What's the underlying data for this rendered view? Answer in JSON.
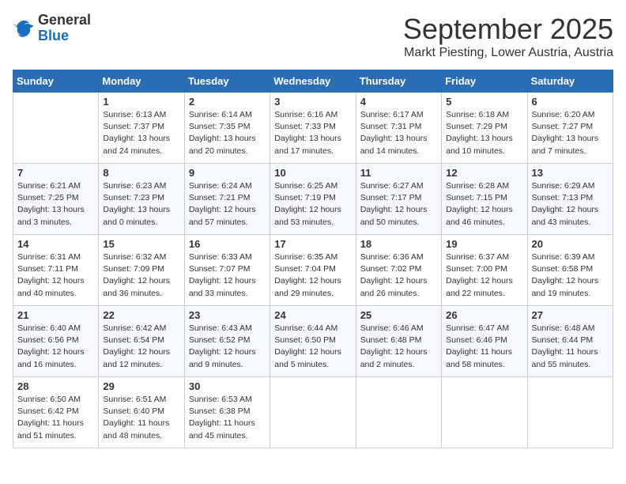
{
  "header": {
    "logo": {
      "line1": "General",
      "line2": "Blue"
    },
    "title": "September 2025",
    "subtitle": "Markt Piesting, Lower Austria, Austria"
  },
  "days_of_week": [
    "Sunday",
    "Monday",
    "Tuesday",
    "Wednesday",
    "Thursday",
    "Friday",
    "Saturday"
  ],
  "weeks": [
    [
      {
        "day": "",
        "content": ""
      },
      {
        "day": "1",
        "content": "Sunrise: 6:13 AM\nSunset: 7:37 PM\nDaylight: 13 hours\nand 24 minutes."
      },
      {
        "day": "2",
        "content": "Sunrise: 6:14 AM\nSunset: 7:35 PM\nDaylight: 13 hours\nand 20 minutes."
      },
      {
        "day": "3",
        "content": "Sunrise: 6:16 AM\nSunset: 7:33 PM\nDaylight: 13 hours\nand 17 minutes."
      },
      {
        "day": "4",
        "content": "Sunrise: 6:17 AM\nSunset: 7:31 PM\nDaylight: 13 hours\nand 14 minutes."
      },
      {
        "day": "5",
        "content": "Sunrise: 6:18 AM\nSunset: 7:29 PM\nDaylight: 13 hours\nand 10 minutes."
      },
      {
        "day": "6",
        "content": "Sunrise: 6:20 AM\nSunset: 7:27 PM\nDaylight: 13 hours\nand 7 minutes."
      }
    ],
    [
      {
        "day": "7",
        "content": "Sunrise: 6:21 AM\nSunset: 7:25 PM\nDaylight: 13 hours\nand 3 minutes."
      },
      {
        "day": "8",
        "content": "Sunrise: 6:23 AM\nSunset: 7:23 PM\nDaylight: 13 hours\nand 0 minutes."
      },
      {
        "day": "9",
        "content": "Sunrise: 6:24 AM\nSunset: 7:21 PM\nDaylight: 12 hours\nand 57 minutes."
      },
      {
        "day": "10",
        "content": "Sunrise: 6:25 AM\nSunset: 7:19 PM\nDaylight: 12 hours\nand 53 minutes."
      },
      {
        "day": "11",
        "content": "Sunrise: 6:27 AM\nSunset: 7:17 PM\nDaylight: 12 hours\nand 50 minutes."
      },
      {
        "day": "12",
        "content": "Sunrise: 6:28 AM\nSunset: 7:15 PM\nDaylight: 12 hours\nand 46 minutes."
      },
      {
        "day": "13",
        "content": "Sunrise: 6:29 AM\nSunset: 7:13 PM\nDaylight: 12 hours\nand 43 minutes."
      }
    ],
    [
      {
        "day": "14",
        "content": "Sunrise: 6:31 AM\nSunset: 7:11 PM\nDaylight: 12 hours\nand 40 minutes."
      },
      {
        "day": "15",
        "content": "Sunrise: 6:32 AM\nSunset: 7:09 PM\nDaylight: 12 hours\nand 36 minutes."
      },
      {
        "day": "16",
        "content": "Sunrise: 6:33 AM\nSunset: 7:07 PM\nDaylight: 12 hours\nand 33 minutes."
      },
      {
        "day": "17",
        "content": "Sunrise: 6:35 AM\nSunset: 7:04 PM\nDaylight: 12 hours\nand 29 minutes."
      },
      {
        "day": "18",
        "content": "Sunrise: 6:36 AM\nSunset: 7:02 PM\nDaylight: 12 hours\nand 26 minutes."
      },
      {
        "day": "19",
        "content": "Sunrise: 6:37 AM\nSunset: 7:00 PM\nDaylight: 12 hours\nand 22 minutes."
      },
      {
        "day": "20",
        "content": "Sunrise: 6:39 AM\nSunset: 6:58 PM\nDaylight: 12 hours\nand 19 minutes."
      }
    ],
    [
      {
        "day": "21",
        "content": "Sunrise: 6:40 AM\nSunset: 6:56 PM\nDaylight: 12 hours\nand 16 minutes."
      },
      {
        "day": "22",
        "content": "Sunrise: 6:42 AM\nSunset: 6:54 PM\nDaylight: 12 hours\nand 12 minutes."
      },
      {
        "day": "23",
        "content": "Sunrise: 6:43 AM\nSunset: 6:52 PM\nDaylight: 12 hours\nand 9 minutes."
      },
      {
        "day": "24",
        "content": "Sunrise: 6:44 AM\nSunset: 6:50 PM\nDaylight: 12 hours\nand 5 minutes."
      },
      {
        "day": "25",
        "content": "Sunrise: 6:46 AM\nSunset: 6:48 PM\nDaylight: 12 hours\nand 2 minutes."
      },
      {
        "day": "26",
        "content": "Sunrise: 6:47 AM\nSunset: 6:46 PM\nDaylight: 11 hours\nand 58 minutes."
      },
      {
        "day": "27",
        "content": "Sunrise: 6:48 AM\nSunset: 6:44 PM\nDaylight: 11 hours\nand 55 minutes."
      }
    ],
    [
      {
        "day": "28",
        "content": "Sunrise: 6:50 AM\nSunset: 6:42 PM\nDaylight: 11 hours\nand 51 minutes."
      },
      {
        "day": "29",
        "content": "Sunrise: 6:51 AM\nSunset: 6:40 PM\nDaylight: 11 hours\nand 48 minutes."
      },
      {
        "day": "30",
        "content": "Sunrise: 6:53 AM\nSunset: 6:38 PM\nDaylight: 11 hours\nand 45 minutes."
      },
      {
        "day": "",
        "content": ""
      },
      {
        "day": "",
        "content": ""
      },
      {
        "day": "",
        "content": ""
      },
      {
        "day": "",
        "content": ""
      }
    ]
  ]
}
